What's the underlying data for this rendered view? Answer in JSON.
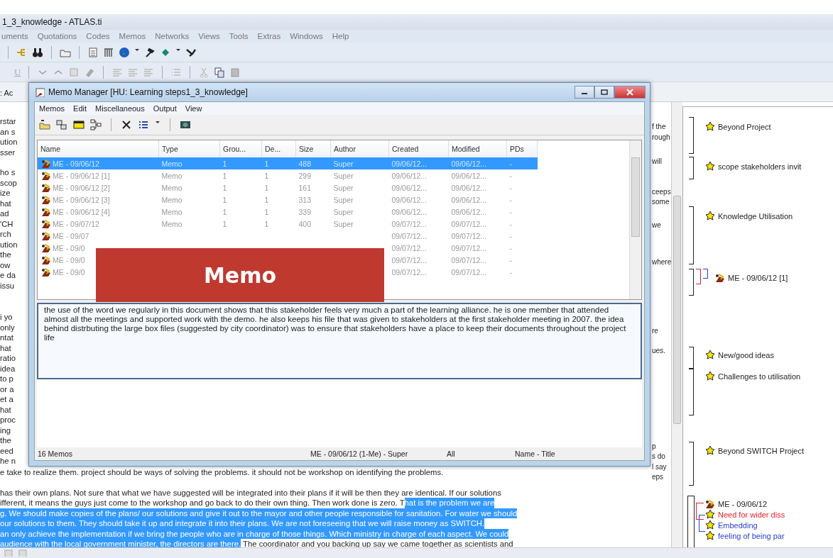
{
  "app_window": {
    "title": "1_3_knowledge - ATLAS.ti"
  },
  "menu": [
    "uments",
    "Quotations",
    "Codes",
    "Memos",
    "Networks",
    "Views",
    "Tools",
    "Extras",
    "Windows",
    "Help"
  ],
  "format_toolbar": {
    "underline_key": "U"
  },
  "document": {
    "tab_fragment": ": Ac",
    "left_fragments": [
      [
        "rstar",
        "an s",
        "ution",
        "sser"
      ],
      [
        "ho s",
        "scop",
        "ize",
        "hat",
        "ad",
        "'CH",
        "rch",
        "ution",
        "the",
        "ow",
        "e da",
        "issu"
      ],
      [
        "i yo",
        "only",
        "ntat",
        "hat",
        "ratio",
        "idea",
        "to p",
        "or a",
        "et a",
        "hat",
        "proc",
        "ing",
        "the",
        "eed",
        "he n"
      ]
    ],
    "right_fragments": [
      [
        "f the",
        "rough"
      ],
      [
        "will"
      ],
      [
        "ceeps",
        "some"
      ],
      [
        "we"
      ],
      [
        "where"
      ],
      [
        "re"
      ],
      [
        "ues."
      ],
      [
        "p",
        "s do",
        "l say",
        "eps"
      ]
    ],
    "lines": [
      {
        "parts": [
          {
            "text": "e take to realize them. project should be ways of solving the problems. it should not be workshop on identifying the problems.",
            "selected": false
          }
        ]
      },
      {
        "parts": [
          {
            "text": "has their own plans. Not sure that what we have suggested will be integrated into their plans if it will be then they are identical. If our solutions",
            "selected": false
          }
        ]
      },
      {
        "parts": [
          {
            "text": "ifferent, it means the guys just come to the workshop and go back to do their own thing. Then work done is zero. T",
            "selected": false
          },
          {
            "text": "hat is the problem we are",
            "selected": true
          }
        ]
      },
      {
        "parts": [
          {
            "text": "g. We should make copies of the plans/ our solutions and give it out to the mayor and other people responsible for sanitation. For water we should",
            "selected": true
          }
        ]
      },
      {
        "parts": [
          {
            "text": "our solutions to them. They should take it up and integrate it into their plans. We are not foreseeing that we will raise money as SWITCH.",
            "selected": true
          }
        ]
      },
      {
        "parts": [
          {
            "text": "an only achieve the implementation if we bring the people who are in charge of those things. Which ministry in charge of each aspect. We could",
            "selected": true
          }
        ]
      },
      {
        "parts": [
          {
            "text": "audience with the local government minister, the directors are there.",
            "selected": true
          },
          {
            "text": " The coordinator and you backing up say we came together as scientists and",
            "selected": false
          }
        ]
      }
    ]
  },
  "margin": [
    {
      "kind": "code",
      "label": "Beyond Project"
    },
    {
      "kind": "code",
      "label": "scope stakeholders invit"
    },
    {
      "kind": "code",
      "label": "Knowledge Utilisation"
    },
    {
      "kind": "memo",
      "label": "ME - 09/06/12 [1]"
    },
    {
      "kind": "code",
      "label": "New/good ideas"
    },
    {
      "kind": "code",
      "label": "Challenges to utilisation"
    },
    {
      "kind": "code",
      "label": "Beyond SWITCH Project"
    },
    {
      "kind": "memo",
      "label": "ME - 09/06/12"
    },
    {
      "kind": "code",
      "label": "Need for wider diss",
      "color": "#e8202a"
    },
    {
      "kind": "code",
      "label": "Embedding",
      "color": "#2a3fd0"
    },
    {
      "kind": "code",
      "label": "feeling of being par",
      "color": "#2a3fd0"
    }
  ],
  "memo_manager": {
    "title": "Memo Manager [HU: Learning steps1_3_knowledge]",
    "menu": [
      "Memos",
      "Edit",
      "Miscellaneous",
      "Output",
      "View"
    ],
    "columns": [
      "Name",
      "Type",
      "Grou...",
      "De...",
      "Size",
      "Author",
      "Created",
      "Modified",
      "PDs"
    ],
    "rows": [
      {
        "selected": true,
        "cells": [
          "ME - 09/06/12",
          "Memo",
          "1",
          "1",
          "488",
          "Super",
          "09/06/12...",
          "09/06/12...",
          "-"
        ]
      },
      {
        "selected": false,
        "cells": [
          "ME - 09/06/12 [1]",
          "Memo",
          "1",
          "1",
          "299",
          "Super",
          "09/06/12...",
          "09/06/12...",
          "-"
        ]
      },
      {
        "selected": false,
        "cells": [
          "ME - 09/06/12 [2]",
          "Memo",
          "1",
          "1",
          "161",
          "Super",
          "09/06/12...",
          "09/06/12...",
          "-"
        ]
      },
      {
        "selected": false,
        "cells": [
          "ME - 09/06/12 [3]",
          "Memo",
          "1",
          "1",
          "313",
          "Super",
          "09/06/12...",
          "09/06/12...",
          "-"
        ]
      },
      {
        "selected": false,
        "cells": [
          "ME - 09/06/12 [4]",
          "Memo",
          "1",
          "1",
          "339",
          "Super",
          "09/06/12...",
          "09/06/12...",
          "-"
        ]
      },
      {
        "selected": false,
        "cells": [
          "ME - 09/07/12",
          "Memo",
          "1",
          "1",
          "400",
          "Super",
          "09/07/12...",
          "09/07/12...",
          "-"
        ]
      },
      {
        "selected": false,
        "cells": [
          "ME - 09/07",
          "",
          "",
          "",
          "",
          "",
          "09/07/12...",
          "09/07/12...",
          "-"
        ]
      },
      {
        "selected": false,
        "cells": [
          "ME - 09/0",
          "",
          "",
          "",
          "",
          "",
          "09/07/12...",
          "09/07/12...",
          "-"
        ]
      },
      {
        "selected": false,
        "cells": [
          "ME - 09/0",
          "",
          "",
          "",
          "",
          "",
          "09/07/12...",
          "09/07/12...",
          "-"
        ]
      },
      {
        "selected": false,
        "cells": [
          "ME - 09/0",
          "",
          "",
          "",
          "",
          "",
          "09/07/12...",
          "09/07/12...",
          "-"
        ]
      }
    ],
    "memo_text": "the use of the word we regularly in this document shows that this stakeholder feels very much a part of the learning alliance. he is one member that attended almost all the meetings and supported work with the demo. he also keeps his file that was given to stakeholders at the first stakeholder meeting in 2007. the idea behind distrbuting the large box files (suggested by city coordinator) was to ensure that stakeholders have a place to keep their documents throughout the project life",
    "status": [
      "16 Memos",
      "ME - 09/06/12 (1-Me) - Super",
      "All",
      "Name - Title"
    ]
  },
  "overlay_caption": "Memo"
}
